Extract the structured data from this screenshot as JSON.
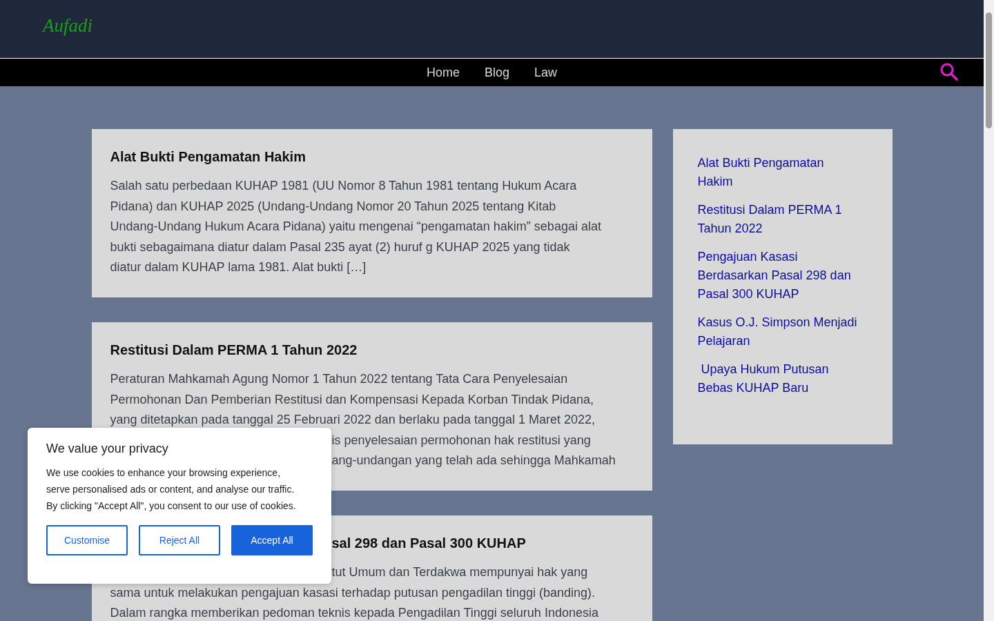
{
  "header": {
    "logo": "Aufadi"
  },
  "nav": {
    "items": [
      {
        "label": "Home"
      },
      {
        "label": "Blog"
      },
      {
        "label": "Law"
      }
    ]
  },
  "posts": [
    {
      "title": {
        "text": "Alat Bukti Pengamatan Hakim",
        "kind": "full"
      },
      "lines": [
        {
          "text": "Salah satu perbedaan KUHAP 1981 (UU Nomor 8 Tahun 1981 tentang Hukum Acara",
          "kind": "full"
        },
        {
          "text": "Pidana) dan KUHAP 2025 (Undang-Undang Nomor 20 Tahun 2025 tentang Kitab",
          "kind": "full"
        },
        {
          "text": "Undang-Undang Hukum Acara Pidana) yaitu mengenai “pengamatan hakim” sebagai alat",
          "kind": "full"
        },
        {
          "text": "bukti sebagaimana diatur dalam Pasal 235 ayat (2) huruf g KUHAP 2025 yang tidak",
          "kind": "full"
        },
        {
          "text": "diatur dalam KUHAP lama 1981. Alat bukti […]",
          "kind": "full"
        }
      ]
    },
    {
      "title": {
        "text": "Restitusi Dalam PERMA 1 Tahun 2022",
        "kind": "full"
      },
      "lines": [
        {
          "text": "Peraturan Mahkamah Agung Nomor 1 Tahun 2022 tentang Tata Cara Penyelesaian",
          "kind": "full"
        },
        {
          "text": "Permohonan Dan Pemberian Restitusi dan Kompensasi Kepada Korban Tindak Pidana,",
          "kind": "full"
        },
        {
          "text": "yang ditetapkan pada tanggal 25 Februari 2022 dan berlaku pada tanggal 1 Maret 2022,",
          "kind": "full"
        },
        {
          "text": "is penyelesaian permohonan hak restitusi yang",
          "kind": "covered"
        },
        {
          "text": "ang-undangan yang telah ada sehingga Mahkamah",
          "kind": "covered"
        }
      ]
    },
    {
      "title": {
        "text": "sal 298 dan Pasal 300 KUHAP",
        "kind": "covered"
      },
      "lines": [
        {
          "text": "tut Umum dan Terdakwa mempunyai hak yang",
          "kind": "covered"
        },
        {
          "text": "sama untuk melakukan pengajuan kasasi terhadap putusan pengadilan tinggi (banding).",
          "kind": "full"
        },
        {
          "text": "Dalam rangka memberikan pedoman teknis kepada Pengadilan Tinggi seluruh Indonesia",
          "kind": "full"
        }
      ]
    }
  ],
  "sidebar": {
    "links": [
      "Alat Bukti Pengamatan Hakim",
      "Restitusi Dalam PERMA 1 Tahun 2022",
      "Pengajuan Kasasi Berdasarkan Pasal 298 dan Pasal 300 KUHAP",
      "Kasus O.J. Simpson Menjadi Pelajaran",
      " Upaya Hukum Putusan Bebas KUHAP Baru"
    ]
  },
  "cookie_banner": {
    "title": "We value your privacy",
    "text": "We use cookies to enhance your browsing experience, serve personalised ads or content, and analyse our traffic. By clicking \"Accept All\", you consent to our use of cookies.",
    "buttons": [
      {
        "label": "Customise",
        "kind": "outline"
      },
      {
        "label": "Reject All",
        "kind": "outline"
      },
      {
        "label": "Accept All",
        "kind": "primary"
      }
    ]
  }
}
